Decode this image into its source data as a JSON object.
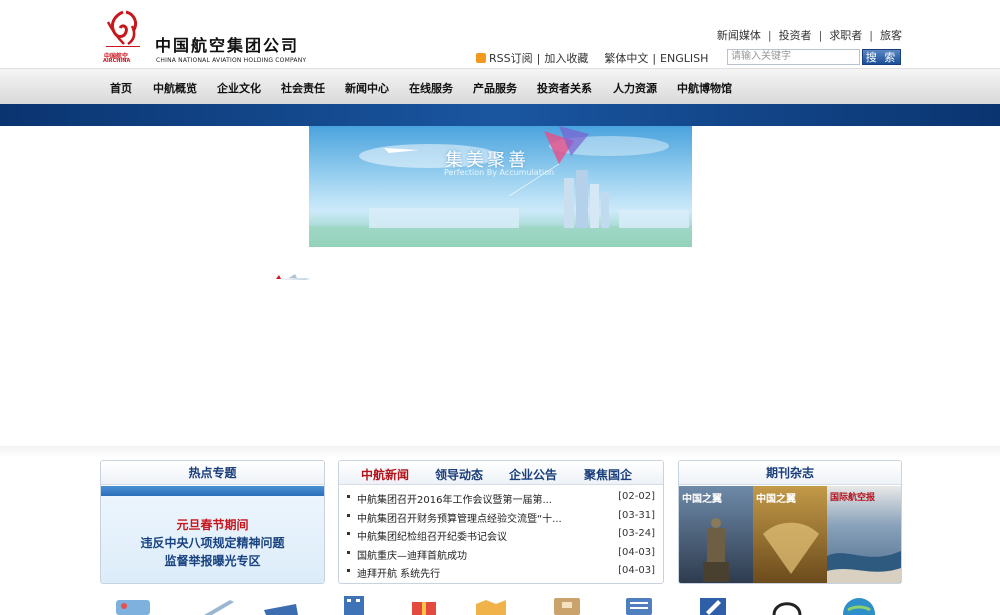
{
  "brand": {
    "name_cn": "中国航空集团公司",
    "name_en": "CHINA NATIONAL AVIATION HOLDING COMPANY",
    "logo_text_cn": "中国航空",
    "logo_text_en": "AIRCHINA",
    "color": "#c8161d"
  },
  "top_links": [
    "新闻媒体",
    "投资者",
    "求职者",
    "旅客"
  ],
  "util_links": {
    "rss": "RSS订阅",
    "favorite": "加入收藏",
    "traditional": "繁体中文",
    "english": "ENGLISH"
  },
  "search": {
    "placeholder": "请输入关键字",
    "button": "搜 索"
  },
  "nav": [
    "首页",
    "中航概览",
    "企业文化",
    "社会责任",
    "新闻中心",
    "在线服务",
    "产品服务",
    "投资者关系",
    "人力资源",
    "中航博物馆"
  ],
  "banner": {
    "title": "集美聚善",
    "subtitle": "Perfection By Accumulation"
  },
  "hot_topics": {
    "title": "热点专题",
    "line1": "元旦春节期间",
    "line2": "违反中央八项规定精神问题",
    "line3": "监督举报曝光专区"
  },
  "news": {
    "tabs": [
      "中航新闻",
      "领导动态",
      "企业公告",
      "聚焦国企"
    ],
    "items": [
      {
        "title": "中航集团召开2016年工作会议暨第一届第...",
        "date": "[02-02]"
      },
      {
        "title": "中航集团召开财务预算管理点经验交流暨“十...",
        "date": "[03-31]"
      },
      {
        "title": "中航集团纪检组召开纪委书记会议",
        "date": "[03-24]"
      },
      {
        "title": "国航重庆—迪拜首航成功",
        "date": "[04-03]"
      },
      {
        "title": "迪拜开航 系统先行",
        "date": "[04-03]"
      }
    ]
  },
  "magazines": {
    "title": "期刊杂志",
    "items": [
      "中国之翼",
      "中国之翼",
      "国际航空报"
    ]
  },
  "colors": {
    "nav_band": "#1a56a0",
    "accent_red": "#b4141b",
    "heading_blue": "#1a3e7a"
  }
}
